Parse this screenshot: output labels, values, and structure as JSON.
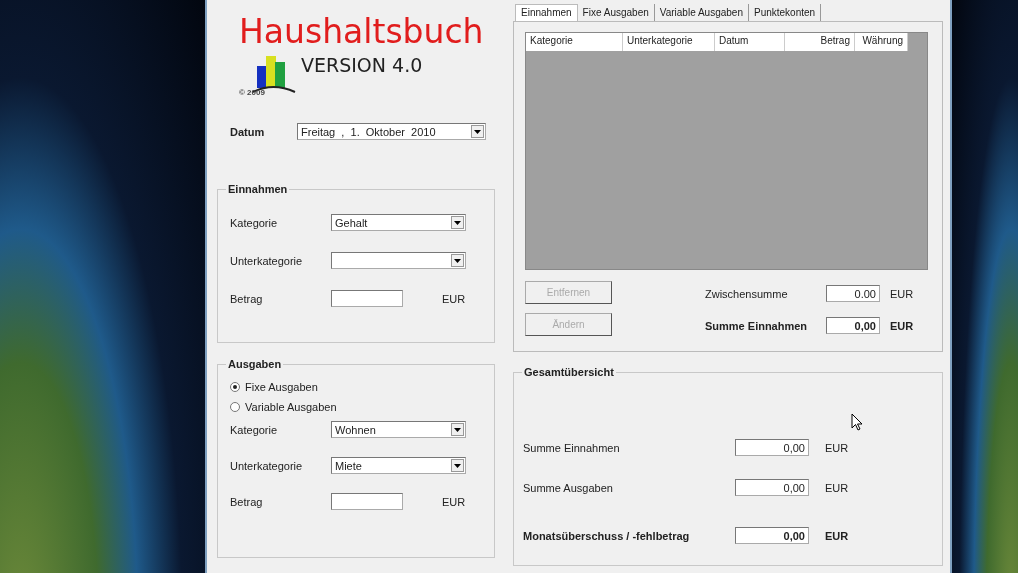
{
  "logo": {
    "title": "Haushaltsbuch",
    "version": "VERSION 4.0",
    "copyright": "© 2009"
  },
  "date": {
    "label": "Datum",
    "value": "Freitag  ,  1.  Oktober  2010"
  },
  "income": {
    "title": "Einnahmen",
    "fields": [
      {
        "kind": "combo",
        "label": "Kategorie",
        "value": "Gehalt"
      },
      {
        "kind": "combo",
        "label": "Unterkategorie"
      },
      {
        "kind": "amount",
        "label": "Betrag",
        "unit": "EUR"
      }
    ]
  },
  "expenses": {
    "title": "Ausgaben",
    "radios": [
      {
        "label": "Fixe Ausgaben",
        "selected": true
      },
      {
        "label": "Variable Ausgaben",
        "selected": false
      }
    ],
    "fields": [
      {
        "kind": "combo",
        "label": "Kategorie",
        "value": "Wohnen"
      },
      {
        "kind": "combo",
        "label": "Unterkategorie",
        "value": "Miete"
      },
      {
        "kind": "amount",
        "label": "Betrag",
        "unit": "EUR"
      }
    ]
  },
  "tabs": [
    {
      "label": "Einnahmen",
      "selected": true
    },
    {
      "label": "Fixe Ausgaben",
      "selected": false
    },
    {
      "label": "Variable Ausgaben",
      "selected": false
    },
    {
      "label": "Punktekonten",
      "selected": false
    }
  ],
  "table": {
    "columns": [
      "Kategorie",
      "Unterkategorie",
      "Datum",
      "Betrag",
      "Währung"
    ]
  },
  "buttons": [
    {
      "label": "Entfernen",
      "disabled": true
    },
    {
      "label": "Ändern",
      "disabled": true
    }
  ],
  "totals": [
    {
      "label": "Zwischensumme",
      "value": "0.00",
      "unit": "EUR",
      "bold": false
    },
    {
      "label": "Summe Einnahmen",
      "value": "0,00",
      "unit": "EUR",
      "bold": true
    }
  ],
  "overview": {
    "title": "Gesamtübersicht",
    "rows": [
      {
        "label": "Summe Einnahmen",
        "value": "0,00",
        "unit": "EUR",
        "bold": false
      },
      {
        "label": "Summe Ausgaben",
        "value": "0,00",
        "unit": "EUR",
        "bold": false
      },
      {
        "label": "Monatsüberschuss / -fehlbetrag",
        "value": "0,00",
        "unit": "EUR",
        "bold": true
      }
    ]
  }
}
